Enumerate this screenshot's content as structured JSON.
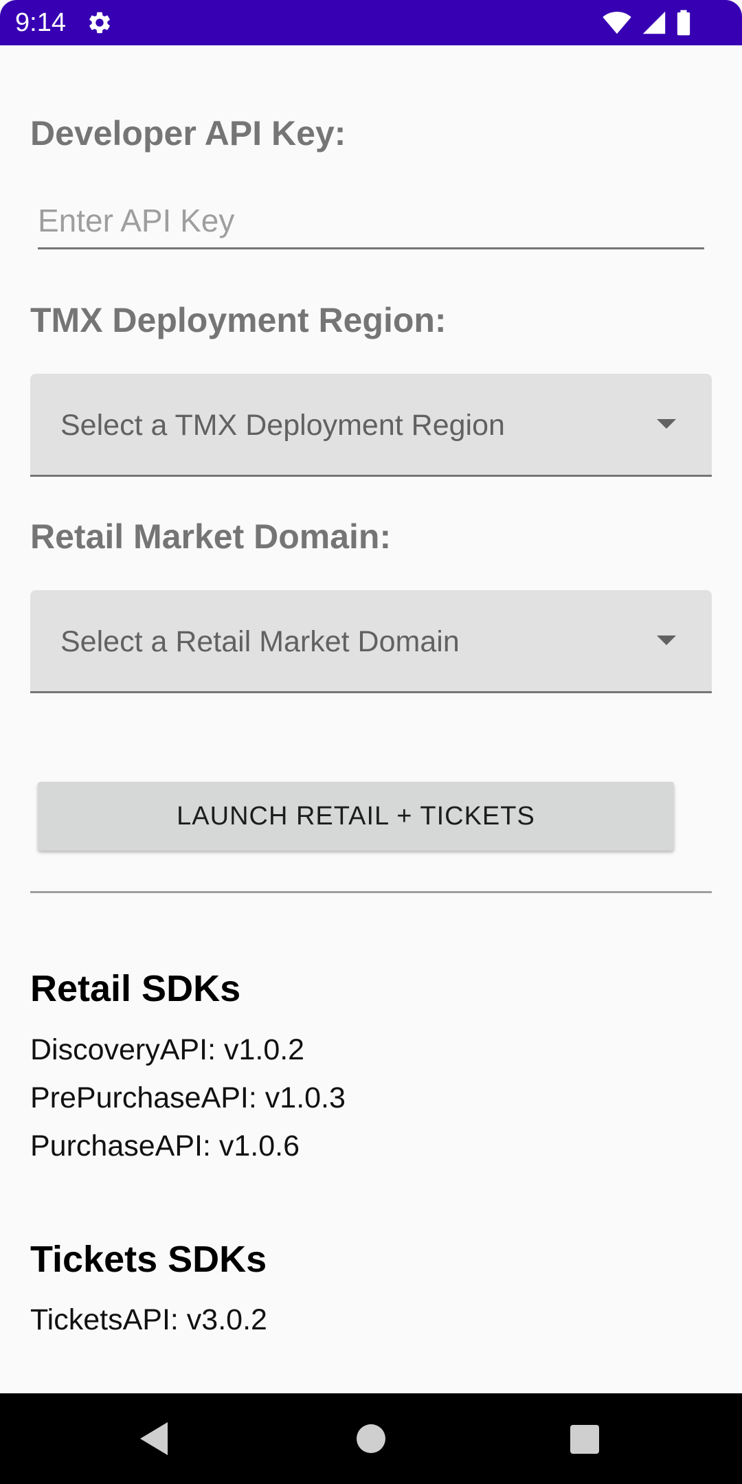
{
  "status_bar": {
    "time": "9:14",
    "background_color": "#3700b3",
    "icons": [
      "gear-icon",
      "wifi-icon",
      "signal-icon",
      "battery-icon"
    ]
  },
  "form": {
    "api_key_label": "Developer API Key:",
    "api_key_placeholder": "Enter API Key",
    "api_key_value": "",
    "region_label": "TMX Deployment Region:",
    "region_placeholder": "Select a TMX Deployment Region",
    "domain_label": "Retail Market Domain:",
    "domain_placeholder": "Select a Retail Market Domain",
    "launch_button": "LAUNCH RETAIL + TICKETS"
  },
  "retail_sdks": {
    "title": "Retail SDKs",
    "items": [
      "DiscoveryAPI: v1.0.2",
      "PrePurchaseAPI: v1.0.3",
      "PurchaseAPI: v1.0.6"
    ]
  },
  "tickets_sdks": {
    "title": "Tickets SDKs",
    "items": [
      "TicketsAPI: v3.0.2"
    ]
  },
  "nav_bar": {
    "icons": [
      "back-icon",
      "home-icon",
      "recents-icon"
    ]
  }
}
